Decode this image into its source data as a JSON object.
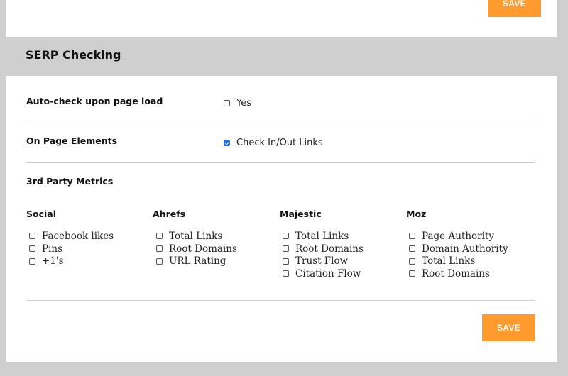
{
  "top": {
    "save_label": "SAVE"
  },
  "section": {
    "title": "SERP Checking"
  },
  "autocheck": {
    "label": "Auto-check upon page load",
    "option": "Yes",
    "checked": false
  },
  "onpage": {
    "label": "On Page Elements",
    "option": "Check In/Out Links",
    "checked": true
  },
  "third_party": {
    "label": "3rd Party Metrics",
    "columns": [
      {
        "title": "Social",
        "items": [
          "Facebook likes",
          "Pins",
          "+1's"
        ]
      },
      {
        "title": "Ahrefs",
        "items": [
          "Total Links",
          "Root Domains",
          "URL Rating"
        ]
      },
      {
        "title": "Majestic",
        "items": [
          "Total Links",
          "Root Domains",
          "Trust Flow",
          "Citation Flow"
        ]
      },
      {
        "title": "Moz",
        "items": [
          "Page Authority",
          "Domain Authority",
          "Total Links",
          "Root Domains"
        ]
      }
    ]
  },
  "bottom": {
    "save_label": "SAVE"
  },
  "colors": {
    "accent": "#ff9a2e",
    "page_bg": "#cfcfcf",
    "card_bg": "#ffffff",
    "check": "#1a73e8"
  }
}
